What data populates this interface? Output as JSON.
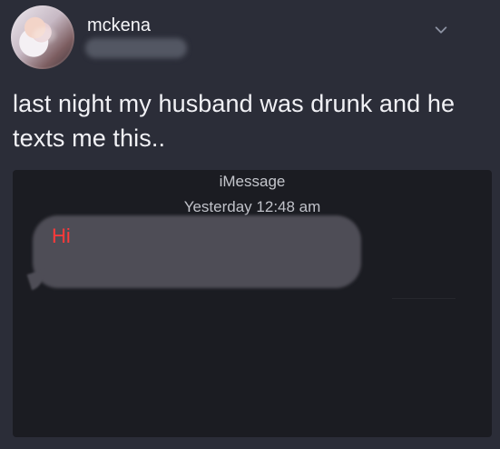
{
  "tweet": {
    "username": "mckena",
    "text": "last night my husband was drunk and he texts me this..",
    "menu_icon": "chevron-down-icon"
  },
  "message": {
    "app": "iMessage",
    "timestamp": "Yesterday 12:48 am",
    "bubble_text": "Hi"
  },
  "colors": {
    "background": "#2b2d38",
    "card_background": "#1b1c22",
    "bubble": "#4e4d56",
    "accent_text": "#ff3a3a"
  }
}
